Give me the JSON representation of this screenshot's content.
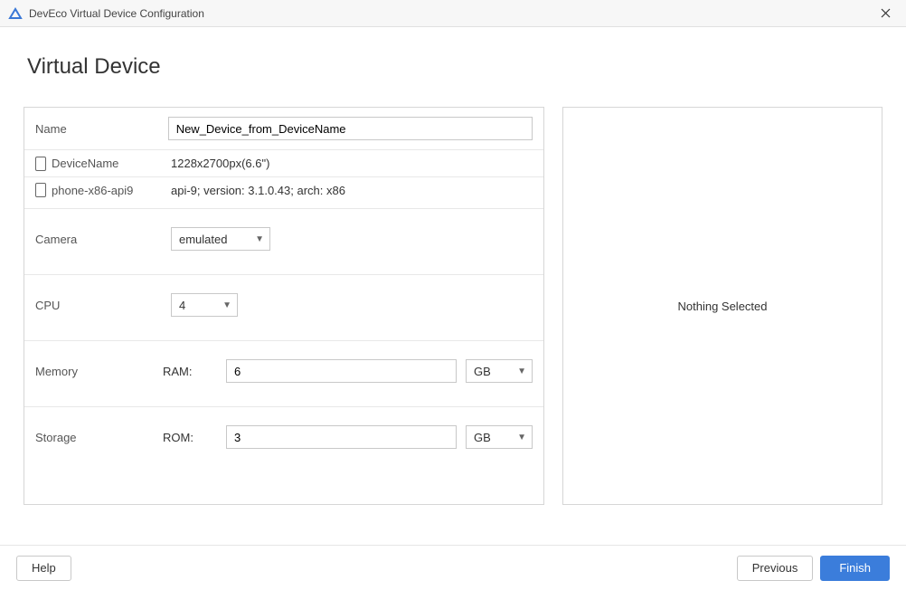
{
  "window": {
    "title": "DevEco Virtual Device Configuration"
  },
  "page": {
    "title": "Virtual Device"
  },
  "form": {
    "name_label": "Name",
    "name_value": "New_Device_from_DeviceName",
    "device_name_label": "DeviceName",
    "device_name_value": "1228x2700px(6.6\")",
    "image_label": "phone-x86-api9",
    "image_value": "api-9; version: 3.1.0.43; arch: x86",
    "camera_label": "Camera",
    "camera_value": "emulated",
    "cpu_label": "CPU",
    "cpu_value": "4",
    "memory_label": "Memory",
    "ram_label": "RAM:",
    "ram_value": "6",
    "ram_unit": "GB",
    "storage_label": "Storage",
    "rom_label": "ROM:",
    "rom_value": "3",
    "rom_unit": "GB"
  },
  "side": {
    "empty_text": "Nothing Selected"
  },
  "footer": {
    "help": "Help",
    "previous": "Previous",
    "finish": "Finish"
  }
}
